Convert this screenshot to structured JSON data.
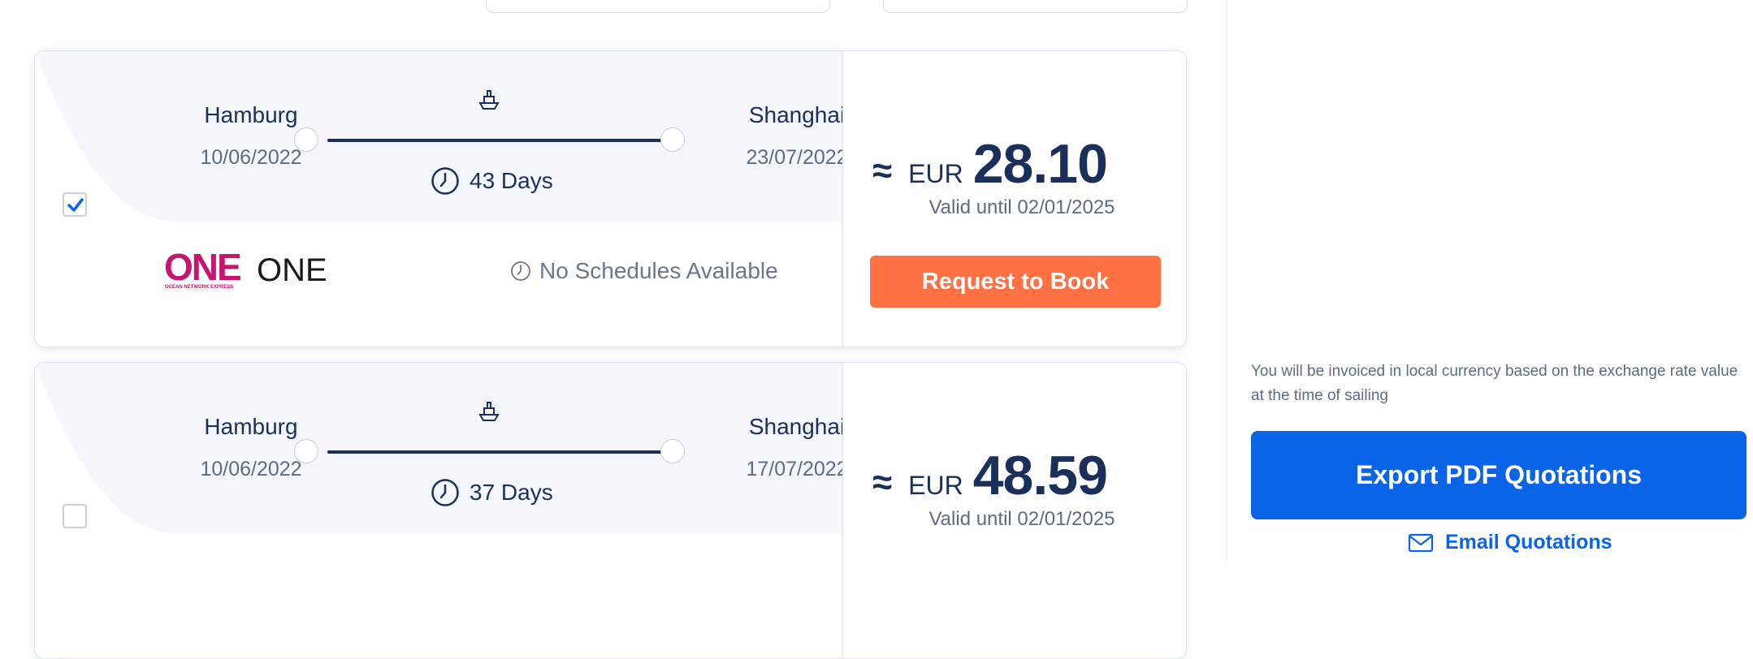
{
  "results": [
    {
      "origin": {
        "name": "Hamburg",
        "date": "10/06/2022"
      },
      "destination": {
        "name": "Shanghai",
        "date": "23/07/2022"
      },
      "duration": "43 Days",
      "selected": true,
      "carrier": {
        "logo_text": "ONE",
        "logo_subtext": "OCEAN NETWORK EXPRESS",
        "name": "ONE"
      },
      "schedule_text": "No Schedules Available",
      "price": {
        "approx": "≈",
        "currency": "EUR",
        "amount": "28.10",
        "valid": "Valid until 02/01/2025"
      },
      "book_label": "Request to Book"
    },
    {
      "origin": {
        "name": "Hamburg",
        "date": "10/06/2022"
      },
      "destination": {
        "name": "Shanghai",
        "date": "17/07/2022"
      },
      "duration": "37 Days",
      "selected": false,
      "price": {
        "approx": "≈",
        "currency": "EUR",
        "amount": "48.59",
        "valid": "Valid until 02/01/2025"
      }
    }
  ],
  "sidebar": {
    "notice": "You will be invoiced in local currency based on the exchange rate value at the time of sailing",
    "export_label": "Export PDF Quotations",
    "email_label": "Email Quotations"
  },
  "colors": {
    "navy": "#1b2f5b",
    "orange": "#ff7043",
    "blue": "#0a64e8",
    "one_magenta": "#c7166f"
  },
  "icons": [
    "ship-icon",
    "clock-icon",
    "check-icon",
    "mail-icon"
  ]
}
